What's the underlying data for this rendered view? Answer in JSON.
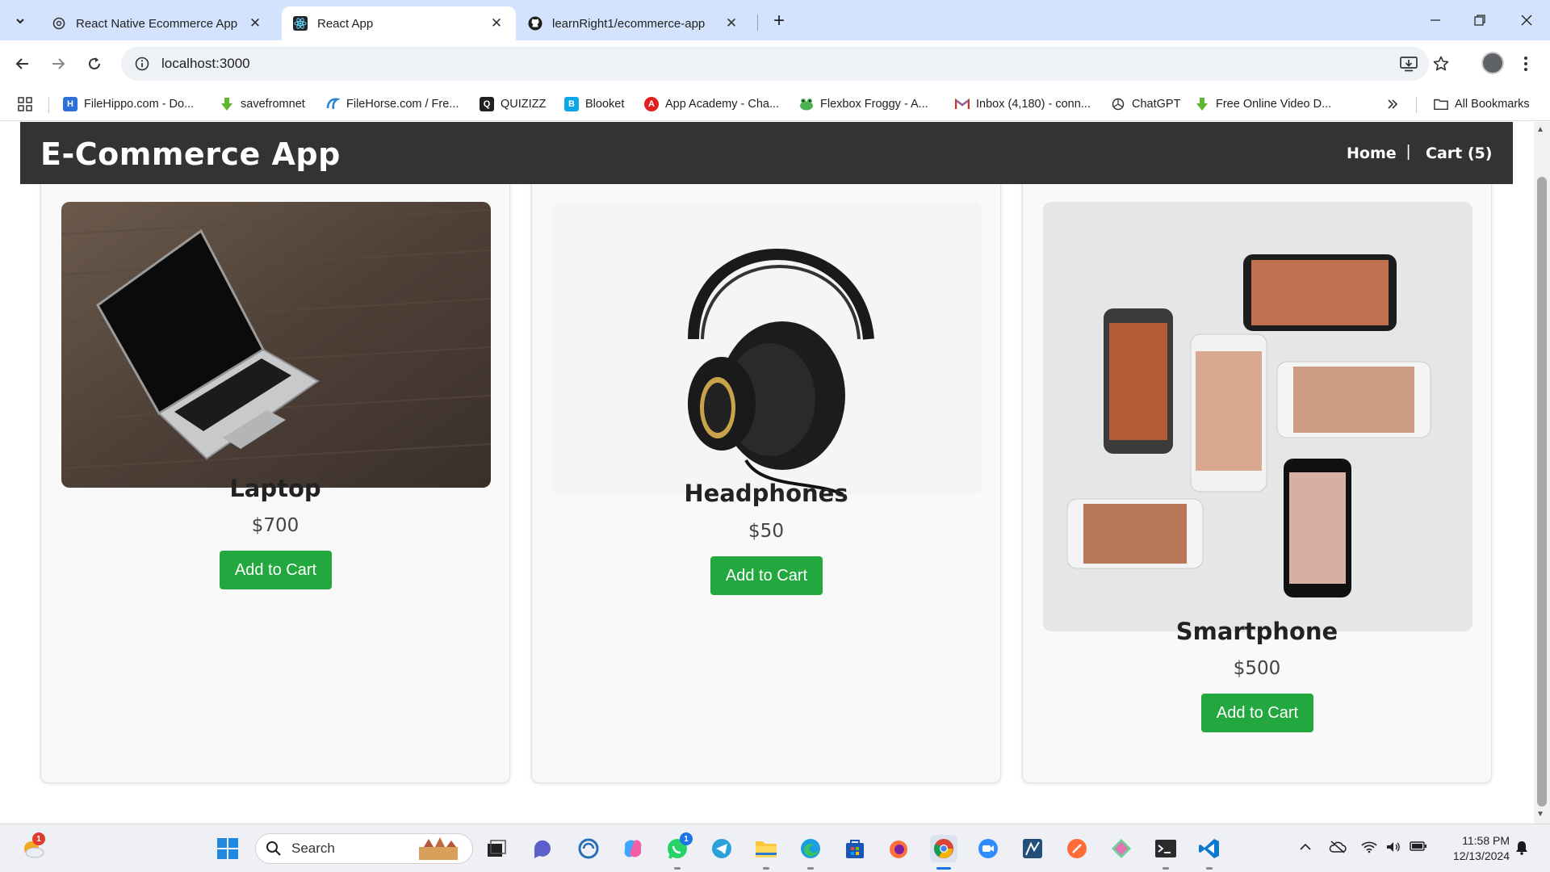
{
  "browser": {
    "tabs": [
      {
        "title": "React Native Ecommerce App",
        "favicon": "openai-icon",
        "active": false
      },
      {
        "title": "React App",
        "favicon": "react-icon",
        "active": true
      },
      {
        "title": "learnRight1/ecommerce-app",
        "favicon": "github-icon",
        "active": false
      }
    ],
    "tab_close_glyph": "✕",
    "new_tab_glyph": "+",
    "url": "localhost:3000"
  },
  "bookmarks": [
    {
      "label": "FileHippo.com - Do...",
      "icon": "filehippo-icon",
      "color": "#2d6fd6"
    },
    {
      "label": "savefromnet",
      "icon": "download-arrow-icon",
      "color": "#5cb82e"
    },
    {
      "label": "FileHorse.com / Fre...",
      "icon": "filehorse-icon",
      "color": "#2b84d6"
    },
    {
      "label": "QUIZIZZ",
      "icon": "quizizz-icon",
      "color": "#222222"
    },
    {
      "label": "Blooket",
      "icon": "blooket-icon",
      "color": "#0ba6e6"
    },
    {
      "label": "App Academy - Cha...",
      "icon": "app-academy-icon",
      "color": "#e02020"
    },
    {
      "label": "Flexbox Froggy - A...",
      "icon": "frog-icon",
      "color": "#4caf50"
    },
    {
      "label": "Inbox (4,180) - conn...",
      "icon": "gmail-icon",
      "color": "#d93025"
    },
    {
      "label": "ChatGPT",
      "icon": "chatgpt-icon",
      "color": "#333333"
    },
    {
      "label": "Free Online Video D...",
      "icon": "download-arrow-icon",
      "color": "#5cb82e"
    }
  ],
  "all_bookmarks": "All Bookmarks",
  "app": {
    "title": "E-Commerce App",
    "nav": {
      "home": "Home",
      "separator": "|",
      "cart": "Cart (5)"
    }
  },
  "products": [
    {
      "name": "Laptop",
      "price": "$700",
      "button": "Add to Cart"
    },
    {
      "name": "Headphones",
      "price": "$50",
      "button": "Add to Cart"
    },
    {
      "name": "Smartphone",
      "price": "$500",
      "button": "Add to Cart"
    }
  ],
  "taskbar": {
    "search_label": "Search",
    "weather_badge": "1",
    "whatsapp_badge": "1",
    "time": "11:58 PM",
    "date": "12/13/2024"
  },
  "colors": {
    "header_bg": "#333333",
    "button_bg": "#22a83f",
    "tabstrip_bg": "#d3e3fd"
  }
}
